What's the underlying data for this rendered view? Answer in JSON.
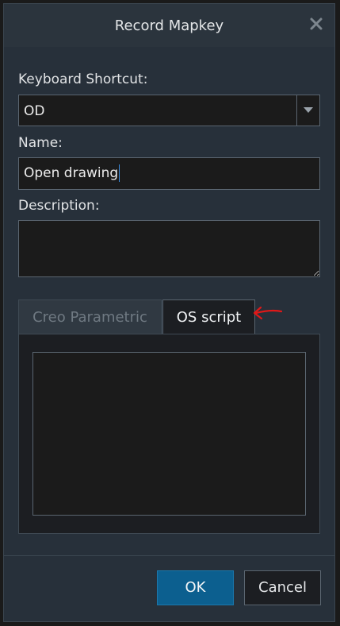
{
  "dialog": {
    "title": "Record Mapkey"
  },
  "form": {
    "shortcut_label": "Keyboard Shortcut:",
    "shortcut_value": "OD",
    "name_label": "Name:",
    "name_value": "Open drawing",
    "description_label": "Description:",
    "description_value": ""
  },
  "tabs": [
    {
      "label": "Creo Parametric",
      "active": false
    },
    {
      "label": "OS script",
      "active": true
    }
  ],
  "buttons": {
    "ok_label": "OK",
    "cancel_label": "Cancel"
  },
  "colors": {
    "accent": "#0c5f8f",
    "annotation": "#e01818"
  },
  "icons": {
    "close": "close-icon",
    "dropdown": "chevron-down-icon",
    "annotation": "arrow-left-icon"
  }
}
